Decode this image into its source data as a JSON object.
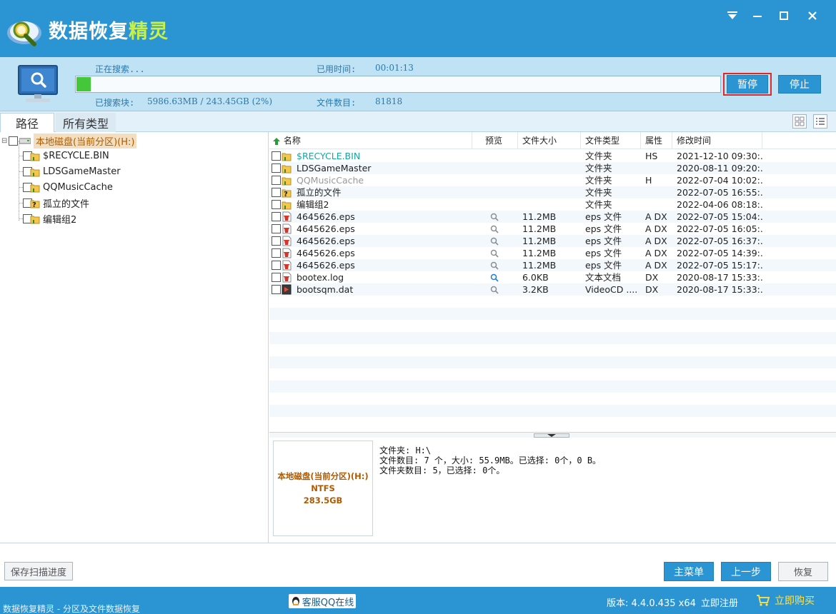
{
  "app": {
    "title_main": "数据恢复",
    "title_accent": "精灵"
  },
  "window": {
    "menu_icon": "dropdown-arrow-icon",
    "minimize_icon": "minimize-icon",
    "maximize_icon": "maximize-icon",
    "close_icon": "close-icon"
  },
  "progress": {
    "status_label": "正在搜索...",
    "elapsed_label": "已用时间:",
    "elapsed_value": "00:01:13",
    "searched_label": "已搜索块:",
    "searched_value": "5986.63MB / 243.45GB (2%)",
    "percent": 2,
    "files_label": "文件数目:",
    "files_value": "81818",
    "pause_label": "暂停",
    "stop_label": "停止"
  },
  "tabs": [
    {
      "label": "路径"
    },
    {
      "label": "所有类型"
    }
  ],
  "tree": {
    "root_label": "本地磁盘(当前分区)(H:)",
    "items": [
      {
        "label": "$RECYCLE.BIN",
        "icon": "folder-recycle-icon"
      },
      {
        "label": "LDSGameMaster",
        "icon": "folder-icon"
      },
      {
        "label": "QQMusicCache",
        "icon": "folder-recycle-icon"
      },
      {
        "label": "孤立的文件",
        "icon": "orphan-folder-icon"
      },
      {
        "label": "编辑组2",
        "icon": "folder-icon"
      }
    ]
  },
  "filelist": {
    "columns": [
      "名称",
      "预览",
      "文件大小",
      "文件类型",
      "属性",
      "修改时间"
    ],
    "rows": [
      {
        "name": "$RECYCLE.BIN",
        "preview": "",
        "size": "",
        "type": "文件夹",
        "attr": "HS",
        "time": "2021-12-10 09:30:...",
        "icon": "folder-icon",
        "color": "#1aa3a0"
      },
      {
        "name": "LDSGameMaster",
        "preview": "",
        "size": "",
        "type": "文件夹",
        "attr": "",
        "time": "2020-08-11 09:20:...",
        "icon": "folder-icon",
        "color": "#222222"
      },
      {
        "name": "QQMusicCache",
        "preview": "",
        "size": "",
        "type": "文件夹",
        "attr": "H",
        "time": "2022-07-04 10:02:...",
        "icon": "folder-icon",
        "color": "#999999"
      },
      {
        "name": "孤立的文件",
        "preview": "",
        "size": "",
        "type": "文件夹",
        "attr": "",
        "time": "2022-07-05 16:55:...",
        "icon": "orphan-folder-icon",
        "color": "#222222"
      },
      {
        "name": "编辑组2",
        "preview": "",
        "size": "",
        "type": "文件夹",
        "attr": "",
        "time": "2022-04-06 08:18:...",
        "icon": "folder-icon",
        "color": "#222222"
      },
      {
        "name": "4645626.eps",
        "preview": "magnifier",
        "size": "11.2MB",
        "type": "eps 文件",
        "attr": "A DX",
        "time": "2022-07-05 15:04:...",
        "icon": "deleted-file-icon",
        "color": "#222222"
      },
      {
        "name": "4645626.eps",
        "preview": "magnifier",
        "size": "11.2MB",
        "type": "eps 文件",
        "attr": "A DX",
        "time": "2022-07-05 16:05:...",
        "icon": "deleted-file-icon",
        "color": "#222222"
      },
      {
        "name": "4645626.eps",
        "preview": "magnifier",
        "size": "11.2MB",
        "type": "eps 文件",
        "attr": "A DX",
        "time": "2022-07-05 16:37:...",
        "icon": "deleted-file-icon",
        "color": "#222222"
      },
      {
        "name": "4645626.eps",
        "preview": "magnifier",
        "size": "11.2MB",
        "type": "eps 文件",
        "attr": "A DX",
        "time": "2022-07-05 14:39:...",
        "icon": "deleted-file-icon",
        "color": "#222222"
      },
      {
        "name": "4645626.eps",
        "preview": "magnifier",
        "size": "11.2MB",
        "type": "eps 文件",
        "attr": "A DX",
        "time": "2022-07-05 15:17:...",
        "icon": "deleted-file-icon",
        "color": "#222222"
      },
      {
        "name": "bootex.log",
        "preview": "magnifier-blue",
        "size": "6.0KB",
        "type": "文本文档",
        "attr": "DX",
        "time": "2020-08-17 15:33:...",
        "icon": "deleted-file-icon",
        "color": "#222222"
      },
      {
        "name": "bootsqm.dat",
        "preview": "magnifier",
        "size": "3.2KB",
        "type": "VideoCD ....",
        "attr": "DX",
        "time": "2020-08-17 15:33:...",
        "icon": "video-file-icon",
        "color": "#222222"
      }
    ]
  },
  "info": {
    "disk_name": "本地磁盘(当前分区)(H:)",
    "disk_fs": "NTFS",
    "disk_size": "283.5GB",
    "line1": "文件夹: H:\\",
    "line2": "文件数目: 7 个，大小: 55.9MB。已选择: 0个，0 B。",
    "line3": "文件夹数目: 5，已选择: 0个。"
  },
  "bottom": {
    "save_progress": "保存扫描进度",
    "main_menu": "主菜单",
    "prev_step": "上一步",
    "recover": "恢复"
  },
  "status": {
    "left_text": "数据恢复精灵 - 分区及文件数据恢复",
    "qq_label": "客服QQ在线",
    "version": "版本: 4.4.0.435 x64",
    "register": "立即注册",
    "buy": "立即购买"
  },
  "colors": {
    "brand_blue": "#2b95d3",
    "accent_green": "#c8f04a",
    "progress_green": "#44c83a",
    "highlight_red": "#e32626",
    "orange_text": "#b05a00"
  }
}
